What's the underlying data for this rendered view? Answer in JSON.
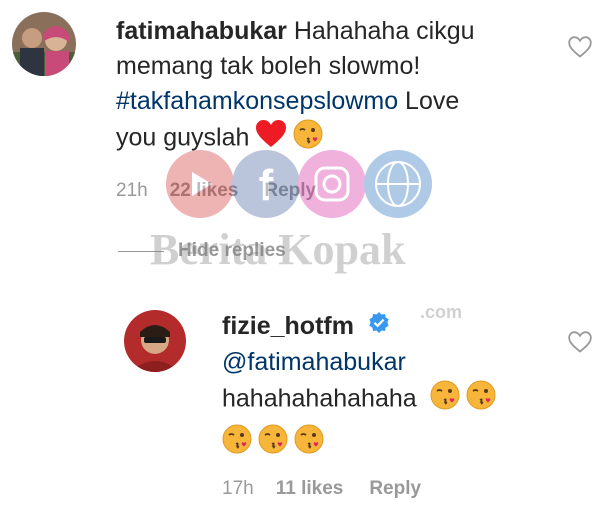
{
  "comment": {
    "username": "fatimahabukar",
    "text_line1": "Hahahaha cikgu",
    "text_line2": "memang tak boleh slowmo!",
    "hashtag": "#takfahamkonsepslowmo",
    "text_line3_tail": "Love",
    "text_line4": "you guyslah",
    "time": "21h",
    "likes": "22 likes",
    "reply_label": "Reply",
    "emojis": [
      "red-heart",
      "face-blowing-kiss"
    ]
  },
  "hide_replies_label": "Hide replies",
  "reply": {
    "username": "fizie_hotfm",
    "verified": true,
    "mention": "@fatimahabukar",
    "text": "hahahahahahaha",
    "time": "17h",
    "likes": "11 likes",
    "reply_label": "Reply",
    "emoji_count_line1": 2,
    "emoji_count_line2": 3
  },
  "watermark": {
    "text": "Berita Kopak",
    "url_text": ".com",
    "icons": [
      "youtube-icon",
      "facebook-icon",
      "instagram-icon",
      "globe-icon"
    ]
  },
  "colors": {
    "text": "#262626",
    "link": "#003569",
    "meta": "#999999",
    "verified": "#3897f0",
    "heart": "#ed1c24",
    "emoji": "#f7b53a"
  }
}
